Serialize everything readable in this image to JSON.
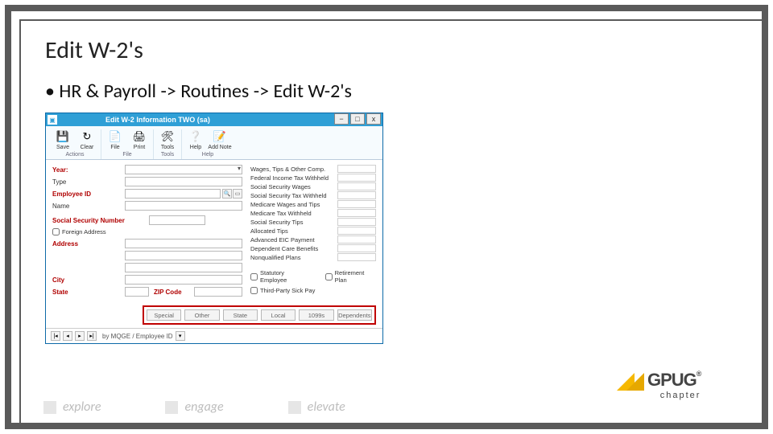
{
  "slide": {
    "title": "Edit W-2's",
    "bullet": "• HR & Payroll -> Routines -> Edit W-2's"
  },
  "window": {
    "title": "Edit W-2 Information       TWO (sa)",
    "controls": {
      "min": "−",
      "max": "□",
      "close": "x"
    }
  },
  "ribbon": {
    "save": "Save",
    "clear": "Clear",
    "file": "File",
    "print": "Print",
    "tools": "Tools",
    "help": "Help",
    "addnote": "Add Note",
    "group1": "Actions",
    "group2": "File",
    "group3": "Tools",
    "group4": "Help"
  },
  "form": {
    "year": "Year:",
    "type": "Type",
    "employeeid": "Employee ID",
    "name": "Name",
    "ssn": "Social Security Number",
    "foreign": "Foreign Address",
    "address": "Address",
    "city": "City",
    "state": "State",
    "zip": "ZIP Code"
  },
  "rightfields": [
    "Wages, Tips & Other Comp.",
    "Federal Income Tax Withheld",
    "Social Security Wages",
    "Social Security Tax Withheld",
    "Medicare Wages and Tips",
    "Medicare Tax Withheld",
    "Social Security Tips",
    "Allocated Tips",
    "Advanced EIC Payment",
    "Dependent Care Benefits",
    "Nonqualified Plans"
  ],
  "checks": {
    "statutory": "Statutory Employee",
    "retirement": "Retirement Plan",
    "thirdparty": "Third-Party Sick Pay"
  },
  "buttons": [
    "Special",
    "Other",
    "State",
    "Local",
    "1099s",
    "Dependents"
  ],
  "nav": {
    "sort": "by MQGE / Employee ID"
  },
  "footer": {
    "a": "explore",
    "b": "engage",
    "c": "elevate"
  },
  "logo": {
    "main": "GPUG",
    "reg": "®",
    "sub": "chapter"
  }
}
